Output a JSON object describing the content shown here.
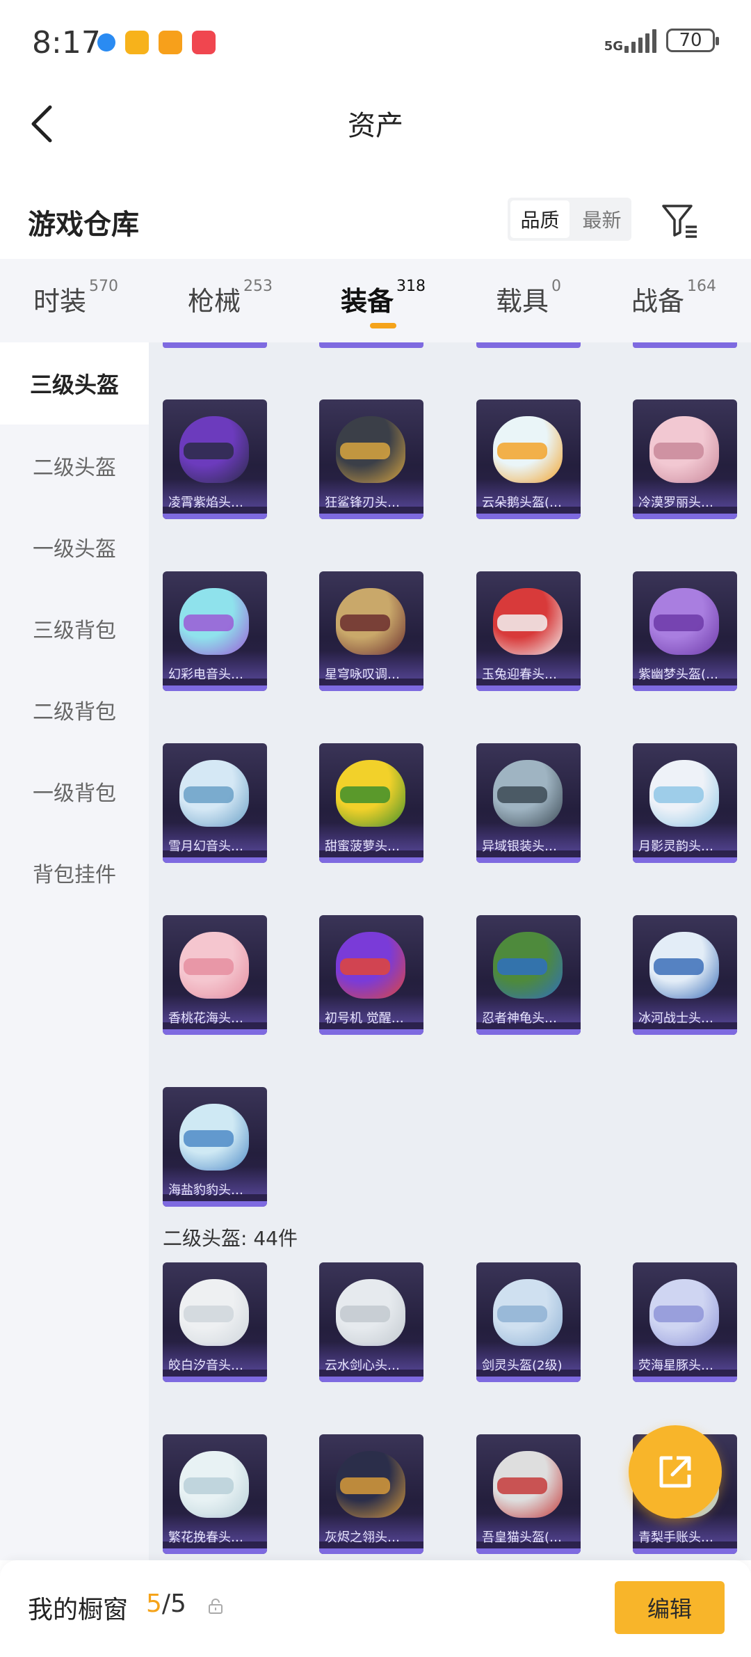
{
  "status_bar": {
    "time": "8:17",
    "network": "5G",
    "battery": "70",
    "app_icons": [
      {
        "name": "browser-icon",
        "color": "#2a8bf2"
      },
      {
        "name": "chat-app-icon",
        "color": "#f7b21b"
      },
      {
        "name": "video-app-icon",
        "color": "#f7a01b"
      },
      {
        "name": "gallery-app-icon",
        "color": "#f0464f"
      }
    ]
  },
  "header": {
    "title": "资产",
    "back_icon": "chevron-left-icon"
  },
  "section": {
    "title": "游戏仓库",
    "sort_options": [
      "品质",
      "最新"
    ],
    "sort_selected": "品质",
    "filter_icon": "filter-icon"
  },
  "tabs": [
    {
      "label": "时装",
      "count": "570"
    },
    {
      "label": "枪械",
      "count": "253"
    },
    {
      "label": "装备",
      "count": "318",
      "active": true
    },
    {
      "label": "载具",
      "count": "0"
    },
    {
      "label": "战备",
      "count": "164"
    }
  ],
  "sidebar": [
    {
      "label": "三级头盔",
      "active": true
    },
    {
      "label": "二级头盔"
    },
    {
      "label": "一级头盔"
    },
    {
      "label": "三级背包"
    },
    {
      "label": "二级背包"
    },
    {
      "label": "一级背包"
    },
    {
      "label": "背包挂件"
    }
  ],
  "items_level3": [
    {
      "name": "凌霄紫焰头…",
      "c1": "#6c3bbd",
      "c2": "#2b2b48"
    },
    {
      "name": "狂鲨锋刃头…",
      "c1": "#3b3f48",
      "c2": "#d9a640"
    },
    {
      "name": "云朵鹅头盔(…",
      "c1": "#eaf5f8",
      "c2": "#f3a32a"
    },
    {
      "name": "冷漠罗丽头…",
      "c1": "#f2c8d2",
      "c2": "#c9889a"
    },
    {
      "name": "幻彩电音头…",
      "c1": "#8fe2ec",
      "c2": "#9b5bd6"
    },
    {
      "name": "星穹咏叹调…",
      "c1": "#c9a86a",
      "c2": "#6b2e2e"
    },
    {
      "name": "玉兔迎春头…",
      "c1": "#d83a3a",
      "c2": "#f2f2f2"
    },
    {
      "name": "紫幽梦头盔(…",
      "c1": "#a97ee0",
      "c2": "#6d3aa8"
    },
    {
      "name": "雪月幻音头…",
      "c1": "#d5e8f5",
      "c2": "#6aa0c7"
    },
    {
      "name": "甜蜜菠萝头…",
      "c1": "#f2d12a",
      "c2": "#3f8f2c"
    },
    {
      "name": "异域银装头…",
      "c1": "#9fb4c2",
      "c2": "#3c4a55"
    },
    {
      "name": "月影灵韵头…",
      "c1": "#eef2f8",
      "c2": "#8fc7e6"
    },
    {
      "name": "香桃花海头…",
      "c1": "#f5c6cf",
      "c2": "#e58ea0"
    },
    {
      "name": "初号机 觉醒…",
      "c1": "#7a3bd8",
      "c2": "#e0463a"
    },
    {
      "name": "忍者神龟头…",
      "c1": "#4e8a3c",
      "c2": "#2f6fbf"
    },
    {
      "name": "冰河战士头…",
      "c1": "#e3edf7",
      "c2": "#3c6fb8"
    },
    {
      "name": "海盐豹豹头…",
      "c1": "#cfe9f4",
      "c2": "#4f8bc7"
    }
  ],
  "group_level2_label": "二级头盔: 44件",
  "items_level2": [
    {
      "name": "皎白汐音头…",
      "c1": "#eef0f2",
      "c2": "#cfd6dc"
    },
    {
      "name": "云水剑心头…",
      "c1": "#e6eaee",
      "c2": "#c2c9cf"
    },
    {
      "name": "剑灵头盔(2级)",
      "c1": "#cfe0f0",
      "c2": "#8fb1d4"
    },
    {
      "name": "荧海星豚头…",
      "c1": "#cfd5f2",
      "c2": "#8f95d8"
    },
    {
      "name": "繁花挽春头…",
      "c1": "#e8f2f4",
      "c2": "#b8d0d8"
    },
    {
      "name": "灰烬之翎头…",
      "c1": "#2b2e4a",
      "c2": "#d79a3a"
    },
    {
      "name": "吾皇猫头盔(…",
      "c1": "#dedede",
      "c2": "#c63b3b"
    },
    {
      "name": "青梨手账头…",
      "c1": "#e3f0f4",
      "c2": "#9fc5d5"
    }
  ],
  "bottom": {
    "title": "我的橱窗",
    "count_used": "5",
    "count_sep": "/",
    "count_total": "5",
    "edit_label": "编辑"
  }
}
